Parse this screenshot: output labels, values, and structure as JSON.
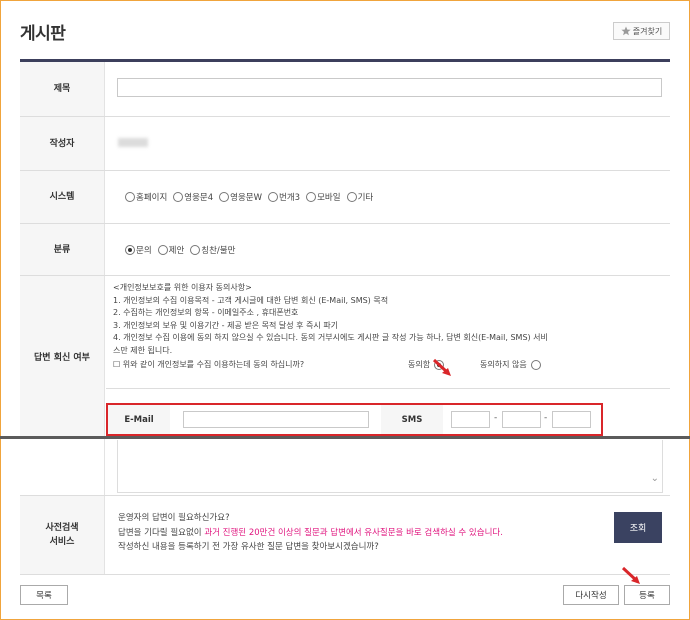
{
  "page": {
    "title": "게시판",
    "favorite_label": "즐겨찾기"
  },
  "form": {
    "subject": {
      "label": "제목",
      "value": ""
    },
    "author": {
      "label": "작성자"
    },
    "system": {
      "label": "시스템",
      "options": [
        "홈페이지",
        "영웅문4",
        "영웅문W",
        "번개3",
        "모바일",
        "기타"
      ],
      "selected": null
    },
    "category": {
      "label": "분류",
      "options": [
        "문의",
        "제안",
        "칭찬/불만"
      ],
      "selected": "문의"
    },
    "reply": {
      "label": "답변 회신 여부",
      "consent_lines": [
        "<개인정보보호를 위한 이용자 동의사항>",
        "1. 개인정보의 수집 이용목적 - 고객 게시글에 대한 답변 회신 (E-Mail, SMS) 목적",
        "2. 수집하는 개인정보의 항목 - 이메일주소 , 휴대폰번호",
        "3. 개인정보의 보유 및 이용기간 - 제공 받은 목적 달성 후 즉시 파기",
        "4. 개인정보 수집 이용에 동의 하지 않으실 수 있습니다. 동의 거부시에도 게시판 글 작성 가능 하나, 답변 회신(E-Mail, SMS) 서비",
        "스만 제한 됩니다."
      ],
      "agree_question": "☐ 위와 같이 개인정보를 수집 이용하는데 동의 하십니까?",
      "agree_label": "동의함",
      "disagree_label": "동의하지 않음",
      "agreed": true,
      "email_label": "E-Mail",
      "email_value": "",
      "sms_label": "SMS",
      "sms_values": [
        "",
        "",
        ""
      ]
    },
    "presearch": {
      "label_line1": "사전검색",
      "label_line2": "서비스",
      "line1": "운영자의 답변이 필요하신가요?",
      "line2_prefix": "답변을 기다릴 필요없이 ",
      "line2_highlight": "과거 진행된 20만건 이상의 질문과 답변에서 유사질문을 바로 검색하실 수 있습니다.",
      "line3": "작성하신 내용을 등록하기 전 가장 유사한 질문 답변을 찾아보시겠습니까?",
      "search_button": "조회"
    }
  },
  "buttons": {
    "list": "목록",
    "rewrite": "다시작성",
    "submit": "등록"
  },
  "colors": {
    "frame": "#f0a43c",
    "header_rule": "#3c3f5c",
    "highlight_box": "#d9262a",
    "pink_text": "#e0157f",
    "search_button": "#3a4261"
  }
}
